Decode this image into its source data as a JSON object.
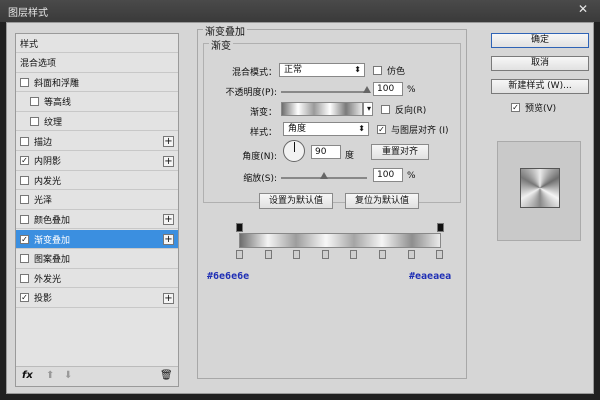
{
  "window": {
    "title": "图层样式",
    "close": "✕"
  },
  "left_panel": {
    "items": [
      {
        "label": "样式",
        "checkbox": false,
        "checked": false,
        "plus": false,
        "active": false
      },
      {
        "label": "混合选项",
        "checkbox": false,
        "checked": false,
        "plus": false,
        "active": false
      },
      {
        "label": "斜面和浮雕",
        "checkbox": true,
        "checked": false,
        "plus": false,
        "active": false
      },
      {
        "label": "等高线",
        "checkbox": true,
        "checked": false,
        "plus": false,
        "active": false,
        "indent": true
      },
      {
        "label": "纹理",
        "checkbox": true,
        "checked": false,
        "plus": false,
        "active": false,
        "indent": true
      },
      {
        "label": "描边",
        "checkbox": true,
        "checked": false,
        "plus": true,
        "active": false
      },
      {
        "label": "内阴影",
        "checkbox": true,
        "checked": true,
        "plus": true,
        "active": false
      },
      {
        "label": "内发光",
        "checkbox": true,
        "checked": false,
        "plus": false,
        "active": false
      },
      {
        "label": "光泽",
        "checkbox": true,
        "checked": false,
        "plus": false,
        "active": false
      },
      {
        "label": "颜色叠加",
        "checkbox": true,
        "checked": false,
        "plus": true,
        "active": false
      },
      {
        "label": "渐变叠加",
        "checkbox": true,
        "checked": true,
        "plus": true,
        "active": true
      },
      {
        "label": "图案叠加",
        "checkbox": true,
        "checked": false,
        "plus": false,
        "active": false
      },
      {
        "label": "外发光",
        "checkbox": true,
        "checked": false,
        "plus": false,
        "active": false
      },
      {
        "label": "投影",
        "checkbox": true,
        "checked": true,
        "plus": true,
        "active": false
      }
    ],
    "footer": {
      "fx": "fx",
      "up": "⬆",
      "down": "⬇",
      "trash": "🗑"
    }
  },
  "gradient_overlay": {
    "group_title": "渐变叠加",
    "sub_title": "渐变",
    "blend_mode_label": "混合模式：",
    "blend_mode_value": "正常",
    "dither_label": "仿色",
    "opacity_label": "不透明度(P):",
    "opacity_value": "100",
    "opacity_percent": 100,
    "percent": "%",
    "gradient_label": "渐变：",
    "reverse_label": "反向(R)",
    "style_label": "样式：",
    "style_value": "角度",
    "align_label": "与图层对齐 (I)",
    "angle_label": "角度(N):",
    "angle_value": "90",
    "degree": "度",
    "reset_align_label": "重置对齐",
    "scale_label": "缩放(S):",
    "scale_value": "100",
    "scale_percent": 100,
    "set_default_label": "设置为默认值",
    "reset_default_label": "复位为默认值"
  },
  "gradient_editor": {
    "left_color": "#6e6e6e",
    "right_color": "#eaeaea"
  },
  "right_panel": {
    "ok_label": "确定",
    "cancel_label": "取消",
    "new_style_label": "新建样式 (W)...",
    "preview_label": "预览(V)",
    "preview_checked": true
  }
}
